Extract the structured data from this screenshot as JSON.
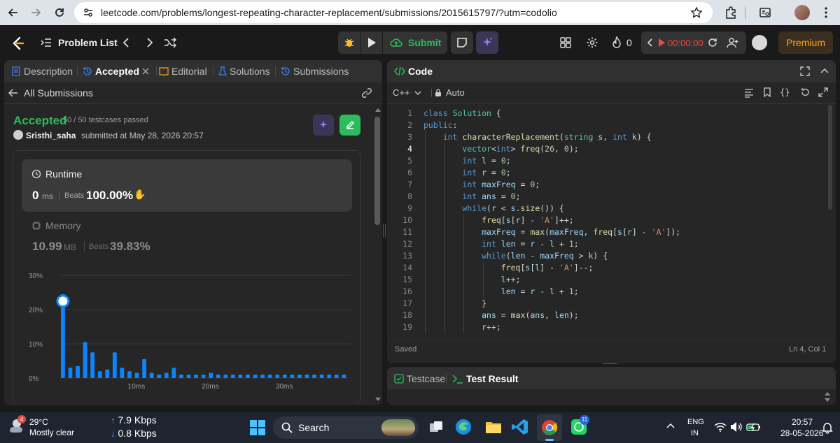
{
  "browser": {
    "url": "leetcode.com/problems/longest-repeating-character-replacement/submissions/2015615797/?utm=codolio"
  },
  "appbar": {
    "problem_list": "Problem List",
    "submit": "Submit",
    "fire_count": "0",
    "timer": "00:00:00",
    "premium": "Premium"
  },
  "left_tabs": [
    {
      "label": "Description"
    },
    {
      "label": "Accepted"
    },
    {
      "label": "Editorial"
    },
    {
      "label": "Solutions"
    },
    {
      "label": "Submissions"
    }
  ],
  "submission": {
    "back_label": "All Submissions",
    "status": "Accepted",
    "testcases": "50 / 50 testcases passed",
    "user": "Sristhi_saha",
    "submitted_text": "submitted at May 28, 2026 20:57",
    "runtime_label": "Runtime",
    "runtime_value": "0",
    "runtime_unit": "ms",
    "beats_label": "Beats",
    "runtime_beats": "100.00%",
    "memory_label": "Memory",
    "memory_value": "10.99",
    "memory_unit": "MB",
    "memory_beats": "39.83%"
  },
  "chart_data": {
    "type": "bar",
    "yticks": [
      "30%",
      "20%",
      "10%",
      "0%"
    ],
    "xticks": [
      "10ms",
      "20ms",
      "30ms"
    ],
    "ylim": [
      0,
      30
    ],
    "values": [
      24.5,
      3,
      3.5,
      10.5,
      7.5,
      2,
      2.5,
      7.5,
      3,
      2,
      1.5,
      5.5,
      1.5,
      1,
      1.5,
      3,
      1,
      1,
      1,
      1,
      1.5,
      1,
      1,
      1,
      1,
      1,
      1,
      1,
      1,
      1,
      1,
      1,
      1,
      1,
      1,
      1,
      1,
      1,
      1
    ],
    "highlight_index": 0,
    "bar_color": "#0a84ff"
  },
  "code_panel": {
    "title": "Code",
    "language": "C++",
    "mode": "Auto",
    "saved": "Saved",
    "cursor": "Ln 4, Col 1",
    "lines": [
      "class Solution {",
      "public:",
      "    int characterReplacement(string s, int k) {",
      "        vector<int> freq(26, 0);",
      "        int l = 0;",
      "        int r = 0;",
      "        int maxFreq = 0;",
      "        int ans = 0;",
      "        while(r < s.size()) {",
      "            freq[s[r] - 'A']++;",
      "            maxFreq = max(maxFreq, freq[s[r] - 'A']);",
      "            int len = r - l + 1;",
      "            while(len - maxFreq > k) {",
      "                freq[s[l] - 'A']--;",
      "                l++;",
      "                len = r - l + 1;",
      "            }",
      "            ans = max(ans, len);",
      "            r++;"
    ]
  },
  "bottom_tabs": {
    "testcase": "Testcase",
    "result": "Test Result"
  },
  "taskbar": {
    "temp": "29°C",
    "weather": "Mostly clear",
    "weather_badge": "4",
    "up_speed": "7.9 Kbps",
    "down_speed": "0.8 Kbps",
    "search": "Search",
    "lang1": "ENG",
    "lang2": "IN",
    "time": "20:57",
    "date": "28-05-2026",
    "whatsapp_badge": "11"
  }
}
